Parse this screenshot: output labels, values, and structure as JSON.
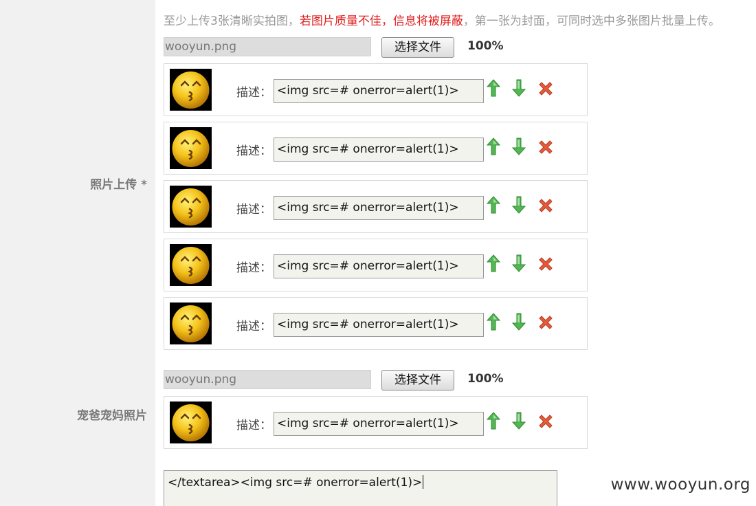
{
  "labels": {
    "photos": "照片上传 *",
    "parents": "宠爸宠妈照片"
  },
  "hint": {
    "part1": "至少上传3张清晰实拍图，",
    "warning": "若图片质量不佳，信息将被屏蔽",
    "part2": "，第一张为封面，可同时选中多张图片批量上传。"
  },
  "uploads": [
    {
      "file_name": "wooyun.png",
      "button": "选择文件",
      "progress": "100%"
    },
    {
      "file_name": "wooyun.png",
      "button": "选择文件",
      "progress": "100%"
    }
  ],
  "photo_rows": [
    {
      "desc_label": "描述：",
      "desc_value": "<img src=# onerror=alert(1)>",
      "thumb_icon": "kissing-face-emoji"
    },
    {
      "desc_label": "描述：",
      "desc_value": "<img src=# onerror=alert(1)>",
      "thumb_icon": "kissing-face-emoji"
    },
    {
      "desc_label": "描述：",
      "desc_value": "<img src=# onerror=alert(1)>",
      "thumb_icon": "kissing-face-emoji"
    },
    {
      "desc_label": "描述：",
      "desc_value": "<img src=# onerror=alert(1)>",
      "thumb_icon": "kissing-face-emoji"
    },
    {
      "desc_label": "描述：",
      "desc_value": "<img src=# onerror=alert(1)>",
      "thumb_icon": "kissing-face-emoji"
    }
  ],
  "parent_rows": [
    {
      "desc_label": "描述：",
      "desc_value": "<img src=# onerror=alert(1)>",
      "thumb_icon": "kissing-face-emoji"
    }
  ],
  "textarea": {
    "value": "</textarea><img src=# onerror=alert(1)>"
  },
  "watermark": "www.wooyun.org",
  "colors": {
    "warning": "#e02020",
    "up_arrow": "#3aa53a",
    "down_arrow": "#3aa53a",
    "delete": "#e04a2a",
    "sidebar_bg": "#f1f1f1"
  }
}
